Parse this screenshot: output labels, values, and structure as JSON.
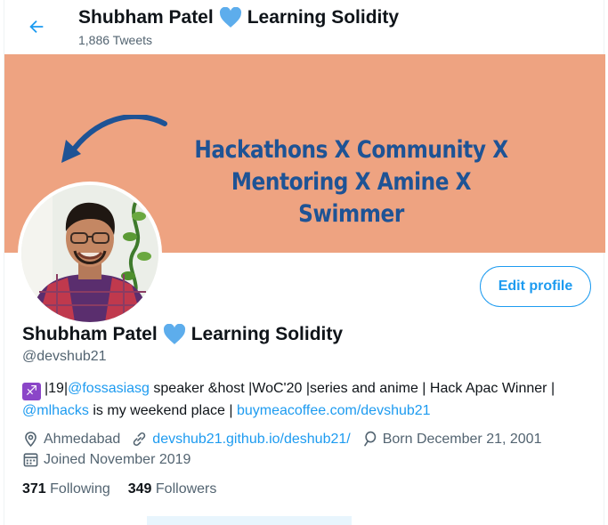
{
  "header": {
    "back_icon": "arrow-left-icon",
    "title_before": "Shubham Patel",
    "title_after": "Learning Solidity",
    "tweets_count": "1,886 Tweets"
  },
  "banner": {
    "line1": "Hackathons X Community X Mentoring X Amine X",
    "line2": "Swimmer",
    "background": "#eea381",
    "text_color": "#1e5395"
  },
  "profile": {
    "edit_label": "Edit profile",
    "name_before": "Shubham Patel",
    "name_after": "Learning Solidity",
    "handle": "@devshub21",
    "heart_icon": "blue-heart-icon",
    "accent": "#1d9bf0"
  },
  "bio": {
    "emoji": "♐",
    "part1": "|19|",
    "mention1": "@fossasiasg",
    "part2": " speaker &host |WoC'20 |series and anime | Hack Apac Winner | ",
    "mention2": "@mlhacks",
    "part3": " is my weekend place | ",
    "url": "buymeacoffee.com/devshub21"
  },
  "meta": {
    "location": "Ahmedabad",
    "website": "devshub21.github.io/deshub21/",
    "birthday": "Born December 21, 2001",
    "joined": "Joined November 2019"
  },
  "stats": {
    "following_count": "371",
    "following_label": "Following",
    "followers_count": "349",
    "followers_label": "Followers"
  }
}
